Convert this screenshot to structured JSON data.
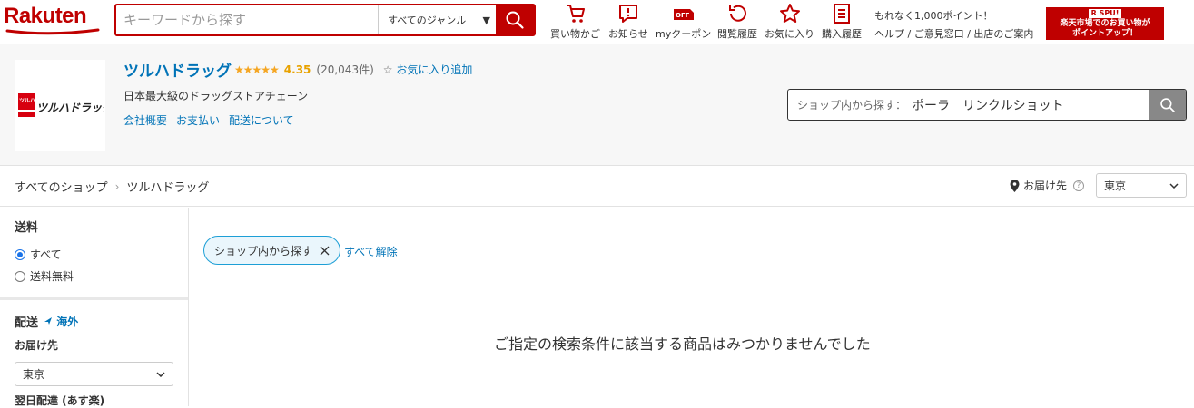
{
  "header": {
    "logo_text": "Rakuten",
    "search_placeholder": "キーワードから探す",
    "genre_label": "すべてのジャンル",
    "nav": [
      {
        "label": "買い物かご",
        "icon": "cart-icon"
      },
      {
        "label": "お知らせ",
        "icon": "notification-icon"
      },
      {
        "label": "myクーポン",
        "icon": "coupon-icon"
      },
      {
        "label": "閲覧履歴",
        "icon": "history-icon"
      },
      {
        "label": "お気に入り",
        "icon": "star-icon"
      },
      {
        "label": "購入履歴",
        "icon": "receipt-icon"
      }
    ],
    "coupon_badge": "OFF",
    "promo_text": "もれなく1,000ポイント！",
    "help_links": [
      "ヘルプ",
      "ご意見窓口",
      "出店のご案内"
    ],
    "spu_banner": {
      "tag": "R SPU!",
      "line1": "楽天市場でのお買い物が",
      "line2": "ポイントアップ！"
    },
    "brand_color": "#bf0000"
  },
  "shop": {
    "logo_text": "ツルハドラッグ",
    "logo_small": "ツルハ",
    "name": "ツルハドラッグ",
    "rating": 4.35,
    "rating_display": "4.35",
    "review_count": "(20,043件)",
    "favorite_label": "お気に入り追加",
    "description": "日本最大級のドラッグストアチェーン",
    "links": [
      "会社概要",
      "お支払い",
      "配送について"
    ],
    "search_label": "ショップ内から探す：",
    "search_value": "ポーラ　リンクルショット"
  },
  "breadcrumb": {
    "items": [
      "すべてのショップ",
      "ツルハドラッグ"
    ],
    "separator": "›"
  },
  "delivery": {
    "label": "お届け先",
    "help": "?",
    "region": "東京"
  },
  "sidebar": {
    "shipping": {
      "title": "送料",
      "options": [
        {
          "label": "すべて",
          "selected": true
        },
        {
          "label": "送料無料",
          "selected": false
        }
      ]
    },
    "delivery": {
      "title": "配送",
      "overseas_label": "海外",
      "dest_label": "お届け先",
      "dest_value": "東京",
      "next_day_label": "翌日配達 (あす楽)"
    }
  },
  "main": {
    "filter_chip": "ショップ内から探す",
    "clear_all": "すべて解除",
    "empty_message": "ご指定の検索条件に該当する商品はみつかりませんでした"
  }
}
